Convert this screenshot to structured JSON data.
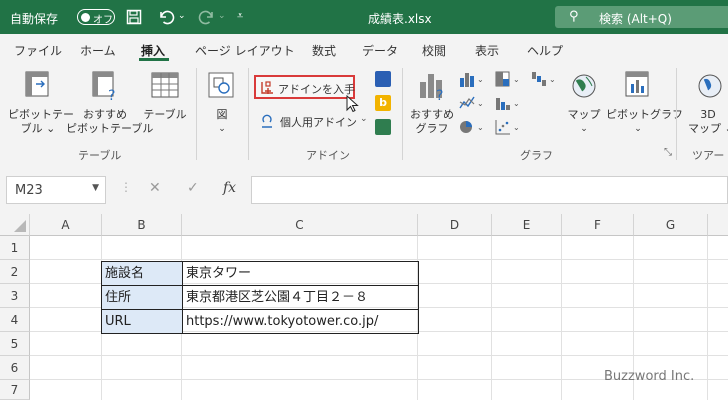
{
  "titlebar": {
    "autosave_label": "自動保存",
    "autosave_state": "オフ",
    "filename": "成績表.xlsx",
    "search_label": "検索 (Alt+Q)"
  },
  "tabs": [
    "ファイル",
    "ホーム",
    "挿入",
    "ページ レイアウト",
    "数式",
    "データ",
    "校閲",
    "表示",
    "ヘルプ"
  ],
  "active_tab": "挿入",
  "ribbon": {
    "pivot_table": [
      "ピボットテー",
      "ブル ⌄"
    ],
    "recommended_pivot": [
      "おすすめ",
      "ピボットテーブル"
    ],
    "table": "テーブル",
    "illustrations": "図",
    "get_addins": "アドインを入手",
    "my_addins": "個人用アドイン",
    "recommended_charts": [
      "おすすめ",
      "グラフ"
    ],
    "maps": "マップ",
    "pivot_chart": "ピボットグラフ",
    "map3d": [
      "3D",
      "マップ ⌄"
    ],
    "group_table": "テーブル",
    "group_addins": "アドイン",
    "group_charts": "グラフ",
    "group_tours": "ツアー"
  },
  "formula_bar": {
    "name_box": "M23",
    "cancel_icon": "✕",
    "enter_icon": "✓",
    "fx_label": "fx",
    "content": ""
  },
  "grid": {
    "columns": [
      "A",
      "B",
      "C",
      "D",
      "E",
      "F",
      "G"
    ],
    "rows": [
      "1",
      "2",
      "3",
      "4",
      "5",
      "6",
      "7"
    ],
    "cells": {
      "B2": "施設名",
      "C2": "東京タワー",
      "B3": "住所",
      "C3": "東京都港区芝公園４丁目２－８",
      "B4": "URL",
      "C4": "https://www.tokyotower.co.jp/"
    },
    "header_fill": "#dde9f7"
  },
  "watermark": "Buzzword Inc.",
  "colors": {
    "accent": "#217346",
    "highlight_border": "#d93a3a"
  }
}
